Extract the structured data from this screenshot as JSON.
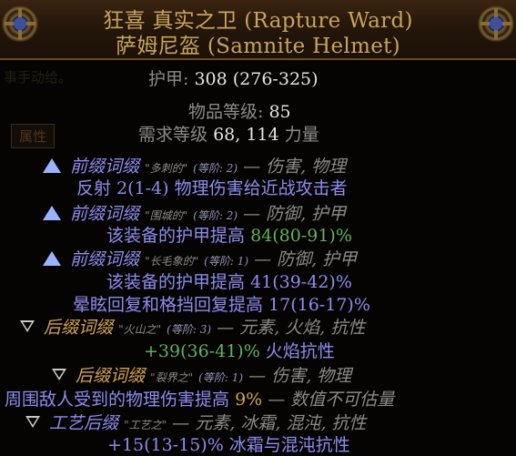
{
  "header": {
    "name_line": "狂喜 真实之卫 (Rapture Ward)",
    "base_line": "萨姆尼盔 (Samnite Helmet)"
  },
  "background": {
    "hint_text": "事手动给。",
    "tab_label": "属性"
  },
  "properties": {
    "armour_label": "护甲:",
    "armour_value": "308 (276-325)",
    "item_level_label": "物品等级:",
    "item_level_value": "85",
    "requirement_label": "需求等级",
    "requirement_value": "68,",
    "strength_value": "114",
    "strength_label": "力量"
  },
  "mods": [
    {
      "kind": "prefix",
      "label": "前缀词缀",
      "name": "\"多刺的\"",
      "tier": "(等阶: 2)",
      "tags": "— 伤害, 物理",
      "lines": [
        {
          "text": "反射 2(1-4) 物理伤害给近战攻击者",
          "highlight": ""
        }
      ]
    },
    {
      "kind": "prefix",
      "label": "前缀词缀",
      "name": "\"围城的\"",
      "tier": "(等阶: 2)",
      "tags": "— 防御, 护甲",
      "lines": [
        {
          "text": "该装备的护甲提高",
          "highlight": "84(80-91)%"
        }
      ]
    },
    {
      "kind": "prefix",
      "label": "前缀词缀",
      "name": "\"长毛象的\"",
      "tier": "(等阶: 1)",
      "tags": "— 防御, 护甲",
      "lines": [
        {
          "text": "该装备的护甲提高 41(39-42)%",
          "highlight": ""
        },
        {
          "text": "晕眩回复和格挡回复提高 17(16-17)%",
          "highlight": ""
        }
      ]
    },
    {
      "kind": "suffix",
      "label": "后缀词缀",
      "name": "\"火山之\"",
      "tier": "(等阶: 3)",
      "tags": "— 元素, 火焰, 抗性",
      "lines": [
        {
          "highlight": "+39(36-41)%",
          "text": "火焰抗性"
        }
      ]
    },
    {
      "kind": "suffix",
      "label": "后缀词缀",
      "name": "\"裂界之\"",
      "tier": "(等阶: 1)",
      "tags": "— 伤害, 物理",
      "lines": [
        {
          "text": "周围敌人受到的物理伤害提高",
          "highlight": "9%",
          "tail": "— 数值不可估量"
        }
      ]
    },
    {
      "kind": "crafted",
      "label": "工艺后缀",
      "name": "\"工艺之\"",
      "tier": "",
      "tags": "— 元素, 冰霜, 混沌, 抗性",
      "lines": [
        {
          "text": "+15(13-15)% 冰霜与混沌抗性",
          "highlight": ""
        }
      ]
    }
  ],
  "colors": {
    "unique_name": "#c9a35a",
    "magic_blue": "#8c8cf0",
    "value_green": "#5db35d",
    "suffix_amber": "#d4a44f",
    "label_grey": "#8a8a8a",
    "value_white": "#e4e4e4"
  }
}
